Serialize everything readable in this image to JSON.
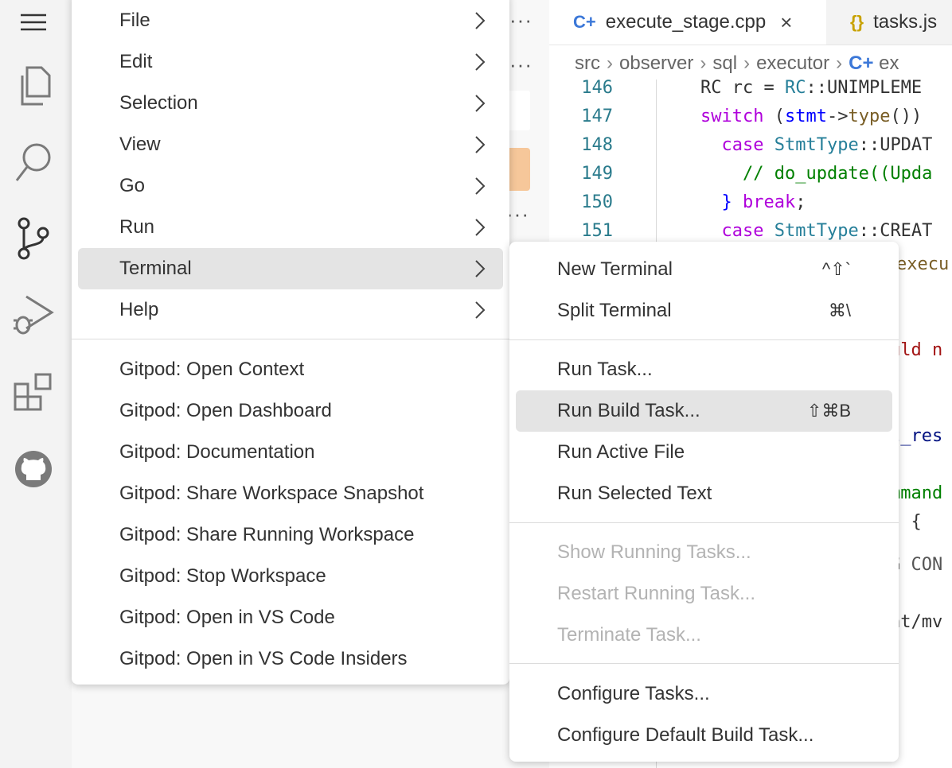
{
  "tabs": [
    {
      "icon": "C+",
      "label": "execute_stage.cpp",
      "close": "×"
    },
    {
      "icon": "{}",
      "label": "tasks.js"
    }
  ],
  "breadcrumb": [
    "src",
    "observer",
    "sql",
    "executor"
  ],
  "breadcrumb_tail": "ex",
  "sidebar": {
    "dots": "···"
  },
  "code": {
    "lines": [
      {
        "n": "146",
        "parts": [
          [
            "",
            "RC rc = "
          ],
          [
            "ty",
            "RC"
          ],
          [
            "",
            "::UNIMPLEME"
          ]
        ]
      },
      {
        "n": "147",
        "parts": [
          [
            "kw",
            "switch"
          ],
          [
            "",
            " ("
          ],
          [
            "bl",
            "stmt"
          ],
          [
            "",
            "->"
          ],
          [
            "fn",
            "type"
          ],
          [
            "",
            "())"
          ]
        ]
      },
      {
        "n": "148",
        "parts": [
          [
            "",
            "  "
          ],
          [
            "kw",
            "case"
          ],
          [
            "",
            " "
          ],
          [
            "ty",
            "StmtType"
          ],
          [
            "",
            "::UPDAT"
          ]
        ]
      },
      {
        "n": "149",
        "parts": [
          [
            "",
            "    "
          ],
          [
            "cm",
            "// do_update((Upda"
          ]
        ]
      },
      {
        "n": "150",
        "parts": [
          [
            "",
            "  "
          ],
          [
            "bl",
            "}"
          ],
          [
            "",
            " "
          ],
          [
            "kw",
            "break"
          ],
          [
            "",
            ";"
          ]
        ]
      },
      {
        "n": "151",
        "parts": [
          [
            "",
            "  "
          ],
          [
            "kw",
            "case"
          ],
          [
            "",
            " "
          ],
          [
            "ty",
            "StmtType"
          ],
          [
            "",
            "::CREAT"
          ]
        ]
      }
    ],
    "fragments": [
      "execu",
      "uld n",
      "l_res",
      "mmand",
      ") {",
      "G CON",
      "at/mv"
    ]
  },
  "menu": {
    "items": [
      {
        "label": "File",
        "submenu": true
      },
      {
        "label": "Edit",
        "submenu": true
      },
      {
        "label": "Selection",
        "submenu": true
      },
      {
        "label": "View",
        "submenu": true
      },
      {
        "label": "Go",
        "submenu": true
      },
      {
        "label": "Run",
        "submenu": true
      },
      {
        "label": "Terminal",
        "submenu": true,
        "highlighted": true
      },
      {
        "label": "Help",
        "submenu": true
      }
    ],
    "gitpod": [
      "Gitpod: Open Context",
      "Gitpod: Open Dashboard",
      "Gitpod: Documentation",
      "Gitpod: Share Workspace Snapshot",
      "Gitpod: Share Running Workspace",
      "Gitpod: Stop Workspace",
      "Gitpod: Open in VS Code",
      "Gitpod: Open in VS Code Insiders"
    ]
  },
  "terminal_menu": {
    "group1": [
      {
        "label": "New Terminal",
        "shortcut": "^⇧`"
      },
      {
        "label": "Split Terminal",
        "shortcut": "⌘\\"
      }
    ],
    "group2": [
      {
        "label": "Run Task...",
        "shortcut": ""
      },
      {
        "label": "Run Build Task...",
        "shortcut": "⇧⌘B",
        "highlighted": true
      },
      {
        "label": "Run Active File",
        "shortcut": ""
      },
      {
        "label": "Run Selected Text",
        "shortcut": ""
      }
    ],
    "group3": [
      {
        "label": "Show Running Tasks...",
        "disabled": true
      },
      {
        "label": "Restart Running Task...",
        "disabled": true
      },
      {
        "label": "Terminate Task...",
        "disabled": true
      }
    ],
    "group4": [
      {
        "label": "Configure Tasks..."
      },
      {
        "label": "Configure Default Build Task..."
      }
    ]
  },
  "colors": {
    "accent": "#f6c79a",
    "highlight": "#e4e4e4",
    "disabled": "#b3b3b3"
  }
}
